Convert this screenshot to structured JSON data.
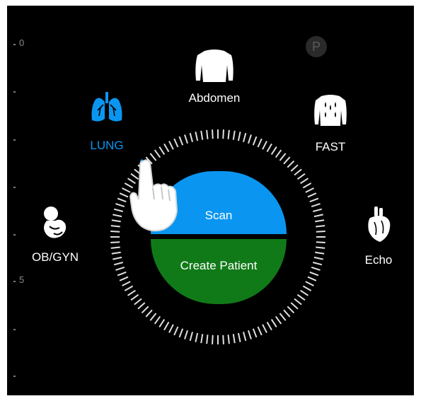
{
  "scale": {
    "top_mark": "0",
    "mid_mark": "5"
  },
  "profile": {
    "badge_text": "P"
  },
  "modes": {
    "abdomen": {
      "label": "Abdomen",
      "icon": "torso-icon"
    },
    "lung": {
      "label": "LUNG",
      "icon": "lungs-icon",
      "selected": true
    },
    "fast": {
      "label": "FAST",
      "icon": "torso-fluid-icon"
    },
    "obgyn": {
      "label": "OB/GYN",
      "icon": "fetus-icon"
    },
    "echo": {
      "label": "Echo",
      "icon": "heart-icon"
    }
  },
  "actions": {
    "scan_label": "Scan",
    "create_patient_label": "Create Patient"
  },
  "colors": {
    "background": "#000000",
    "accent": "#0a96f0",
    "scan": "#0a96f0",
    "create_patient": "#117a18",
    "ring_ticks": "#e0e0e0"
  }
}
